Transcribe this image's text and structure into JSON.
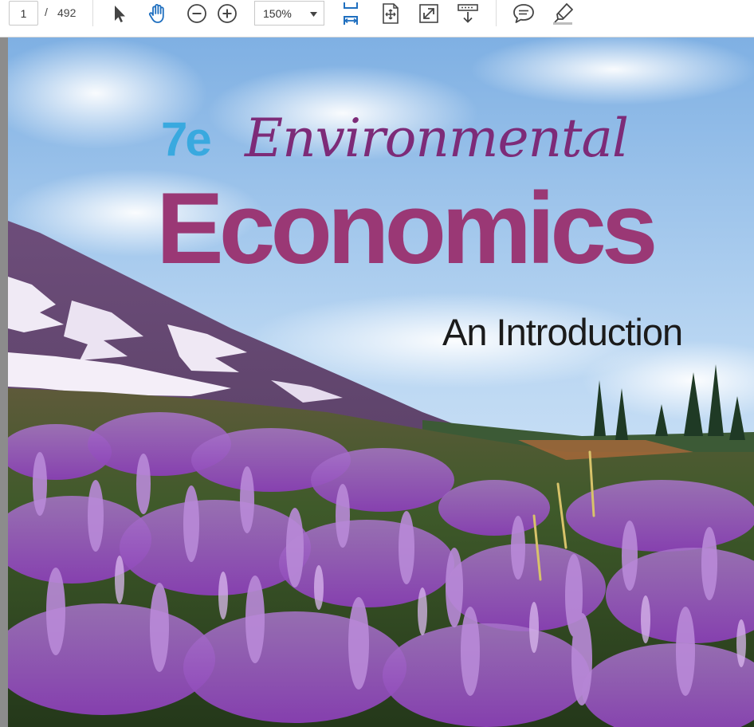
{
  "toolbar": {
    "page_current": "1",
    "page_separator": "/",
    "page_total": "492",
    "zoom_level": "150%",
    "icons": [
      "cursor-select-icon",
      "hand-pan-icon",
      "zoom-out-icon",
      "zoom-in-icon",
      "fit-page-icon",
      "fit-width-icon",
      "fullscreen-icon",
      "scroll-mode-icon",
      "comment-icon",
      "highlight-icon"
    ]
  },
  "cover": {
    "edition": "7e",
    "title_line1": "Environmental",
    "title_line2": "Economics",
    "subtitle": "An Introduction"
  },
  "colors": {
    "edition_blue": "#39a9df",
    "title_purple": "#7d2b78",
    "title_magenta": "#9a3875",
    "subtitle_black": "#1b1b1b",
    "toolbar_icon_blue": "#1f6fbf"
  }
}
